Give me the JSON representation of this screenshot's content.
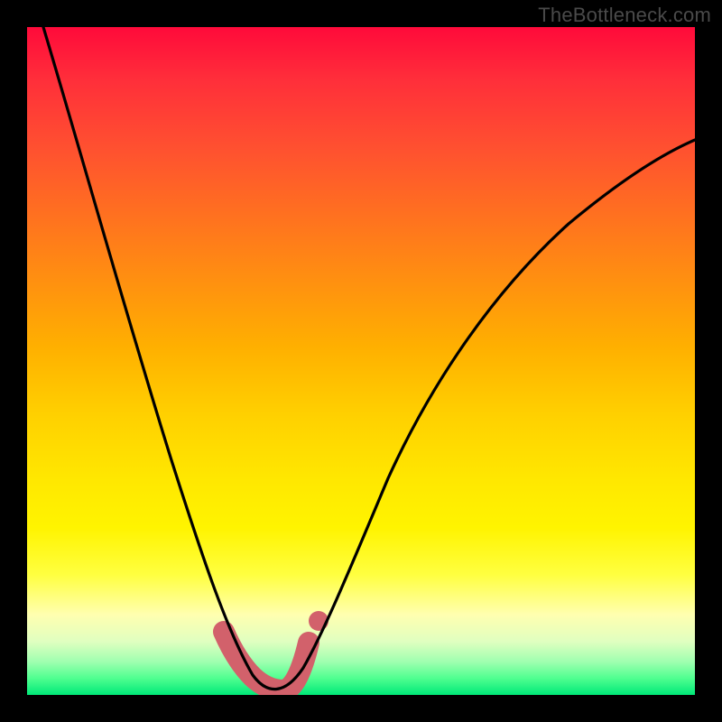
{
  "watermark": "TheBottleneck.com",
  "chart_data": {
    "type": "line",
    "title": "",
    "xlabel": "",
    "ylabel": "",
    "xlim": [
      0,
      100
    ],
    "ylim": [
      0,
      100
    ],
    "series": [
      {
        "name": "bottleneck-curve",
        "x": [
          2,
          5,
          8,
          12,
          16,
          20,
          24,
          27,
          29,
          31,
          33,
          35,
          37,
          39,
          41,
          44,
          48,
          53,
          60,
          68,
          78,
          90,
          100
        ],
        "y": [
          100,
          88,
          76,
          63,
          50,
          38,
          27,
          18,
          12,
          7,
          3,
          1,
          0.5,
          1,
          3,
          8,
          16,
          27,
          40,
          52,
          63,
          72,
          78
        ]
      }
    ],
    "markers": {
      "name": "highlight-band",
      "color": "#d2616b",
      "x": [
        29.5,
        31,
        33,
        35,
        37,
        39,
        41,
        42.3
      ],
      "y": [
        9.5,
        5,
        2,
        1,
        0.8,
        1.5,
        4,
        7.5
      ]
    },
    "gradient_stops": [
      {
        "pos": 0,
        "color": "#ff0a3a"
      },
      {
        "pos": 50,
        "color": "#ffd000"
      },
      {
        "pos": 85,
        "color": "#ffff80"
      },
      {
        "pos": 100,
        "color": "#00e878"
      }
    ]
  }
}
